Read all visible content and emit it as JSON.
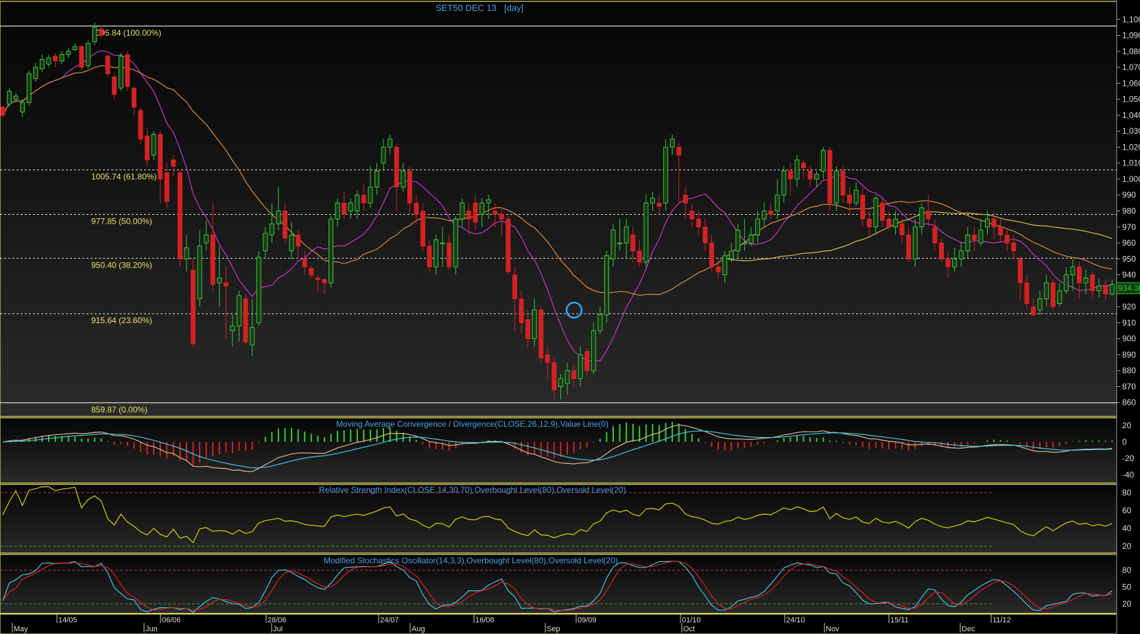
{
  "title": "SET50 DEC 13",
  "period": "[day]",
  "last_price": "934.30",
  "price_axis_labels": [
    "1,100",
    "1,090",
    "1,080",
    "1,070",
    "1,060",
    "1,050",
    "1,040",
    "1,030",
    "1,020",
    "1,010",
    "1,000",
    "990",
    "980",
    "970",
    "960",
    "950",
    "940",
    "930",
    "920",
    "910",
    "900",
    "890",
    "880",
    "870",
    "860"
  ],
  "fib_levels": [
    {
      "label": "1095.84 (100.00%)",
      "value": 1095.84
    },
    {
      "label": "1005.74 (61.80%)",
      "value": 1005.74
    },
    {
      "label": "977.85 (50.00%)",
      "value": 977.85
    },
    {
      "label": "950.40 (38.20%)",
      "value": 950.4
    },
    {
      "label": "915.64 (23.60%)",
      "value": 915.64
    },
    {
      "label": "859.87 (0.00%)",
      "value": 859.87
    }
  ],
  "date_axis_top": [
    "14/05",
    "06/06",
    "28/06",
    "24/07",
    "16/08",
    "09/09",
    "01/10",
    "24/10",
    "15/11",
    "11/12"
  ],
  "date_axis_bottom": [
    "May",
    "Jun",
    "Jul",
    "Aug",
    "Sep",
    "Oct",
    "Nov",
    "Dec"
  ],
  "macd": {
    "title": "Moving Average Convergence / Divergence(CLOSE,26,12,9),Value Line(0)",
    "axis": [
      "20",
      "0",
      "-20",
      "-40"
    ]
  },
  "rsi": {
    "title": "Relative Strength Index(CLOSE,14,30,70),Overbought Level(80),Oversold Level(20)",
    "axis": [
      "80",
      "60",
      "40",
      "20"
    ]
  },
  "stoch": {
    "title": "Modified Stochastics Oscillator(14,3,3),Overbought Level(80),Oversold Level(20)",
    "axis": [
      "80",
      "50",
      "20"
    ]
  },
  "colors": {
    "up": "#33cc33",
    "down": "#d42222",
    "ma_fast": "#cc33cc",
    "ma_slow": "#e08a3c",
    "ma_long": "#d4c24a",
    "rsi": "#d4d400",
    "stoch_k": "#40c8e0",
    "stoch_d": "#e02020",
    "title": "#4a9fe0",
    "frame": "#e8e066"
  },
  "chart_data": {
    "type": "candlestick",
    "title": "SET50 DEC 13",
    "ylim": [
      855,
      1103
    ],
    "candles": [
      [
        1045,
        1040,
        1046,
        1038
      ],
      [
        1047,
        1055,
        1057,
        1045
      ],
      [
        1050,
        1052,
        1054,
        1048
      ],
      [
        1042,
        1048,
        1050,
        1039
      ],
      [
        1048,
        1066,
        1068,
        1046
      ],
      [
        1063,
        1070,
        1073,
        1061
      ],
      [
        1069,
        1075,
        1078,
        1067
      ],
      [
        1072,
        1076,
        1078,
        1070
      ],
      [
        1077,
        1074,
        1079,
        1070
      ],
      [
        1074,
        1078,
        1080,
        1072
      ],
      [
        1078,
        1080,
        1082,
        1076
      ],
      [
        1081,
        1083,
        1085,
        1080
      ],
      [
        1083,
        1070,
        1084,
        1068
      ],
      [
        1071,
        1085,
        1087,
        1069
      ],
      [
        1086,
        1095,
        1098,
        1084
      ],
      [
        1094,
        1090,
        1096,
        1088
      ],
      [
        1077,
        1066,
        1078,
        1064
      ],
      [
        1064,
        1053,
        1066,
        1050
      ],
      [
        1057,
        1077,
        1079,
        1055
      ],
      [
        1078,
        1058,
        1080,
        1055
      ],
      [
        1057,
        1045,
        1058,
        1040
      ],
      [
        1043,
        1025,
        1045,
        1022
      ],
      [
        1027,
        1012,
        1032,
        1008
      ],
      [
        1015,
        1028,
        1030,
        1012
      ],
      [
        1028,
        1000,
        1030,
        985
      ],
      [
        1004,
        986,
        1010,
        982
      ],
      [
        1012,
        1008,
        1015,
        1002
      ],
      [
        1004,
        950,
        1006,
        945
      ],
      [
        950,
        957,
        965,
        942
      ],
      [
        943,
        897,
        950,
        895
      ],
      [
        925,
        958,
        968,
        920
      ],
      [
        960,
        965,
        974,
        955
      ],
      [
        965,
        934,
        985,
        930
      ],
      [
        935,
        938,
        958,
        920
      ],
      [
        935,
        933,
        945,
        900
      ],
      [
        905,
        908,
        915,
        895
      ],
      [
        908,
        927,
        930,
        898
      ],
      [
        925,
        898,
        928,
        896
      ],
      [
        896,
        907,
        925,
        889
      ],
      [
        910,
        951,
        955,
        908
      ],
      [
        955,
        966,
        970,
        950
      ],
      [
        965,
        972,
        985,
        960
      ],
      [
        972,
        980,
        995,
        968
      ],
      [
        980,
        963,
        985,
        960
      ],
      [
        955,
        965,
        973,
        950
      ],
      [
        965,
        958,
        968,
        950
      ],
      [
        950,
        945,
        955,
        940
      ],
      [
        944,
        940,
        946,
        938
      ],
      [
        938,
        937,
        940,
        930
      ],
      [
        937,
        935,
        938,
        928
      ],
      [
        935,
        975,
        977,
        932
      ],
      [
        975,
        985,
        988,
        970
      ],
      [
        985,
        978,
        992,
        975
      ],
      [
        980,
        985,
        988,
        975
      ],
      [
        980,
        990,
        993,
        975
      ],
      [
        990,
        985,
        997,
        980
      ],
      [
        985,
        995,
        1008,
        982
      ],
      [
        995,
        1005,
        1010,
        990
      ],
      [
        1010,
        1020,
        1025,
        1005
      ],
      [
        1020,
        1025,
        1028,
        1015
      ],
      [
        1020,
        995,
        1022,
        980
      ],
      [
        995,
        1005,
        1010,
        992
      ],
      [
        1005,
        985,
        1008,
        978
      ],
      [
        985,
        978,
        990,
        972
      ],
      [
        980,
        958,
        985,
        955
      ],
      [
        958,
        945,
        962,
        942
      ],
      [
        945,
        962,
        965,
        940
      ],
      [
        960,
        960,
        970,
        945
      ],
      [
        960,
        945,
        965,
        943
      ],
      [
        945,
        975,
        977,
        940
      ],
      [
        975,
        985,
        988,
        970
      ],
      [
        980,
        975,
        985,
        965
      ],
      [
        985,
        973,
        990,
        968
      ],
      [
        978,
        985,
        988,
        970
      ],
      [
        985,
        987,
        990,
        975
      ],
      [
        980,
        978,
        985,
        970
      ],
      [
        978,
        975,
        982,
        965
      ],
      [
        975,
        942,
        977,
        940
      ],
      [
        940,
        925,
        945,
        905
      ],
      [
        925,
        910,
        930,
        903
      ],
      [
        912,
        900,
        918,
        895
      ],
      [
        900,
        918,
        925,
        895
      ],
      [
        918,
        888,
        920,
        885
      ],
      [
        890,
        885,
        895,
        875
      ],
      [
        885,
        868,
        888,
        862
      ],
      [
        870,
        875,
        878,
        862
      ],
      [
        872,
        880,
        885,
        865
      ],
      [
        880,
        875,
        883,
        870
      ],
      [
        875,
        890,
        895,
        870
      ],
      [
        892,
        880,
        894,
        876
      ],
      [
        880,
        905,
        910,
        878
      ],
      [
        905,
        915,
        920,
        903
      ],
      [
        915,
        952,
        955,
        910
      ],
      [
        950,
        968,
        972,
        945
      ],
      [
        960,
        960,
        975,
        955
      ],
      [
        960,
        970,
        975,
        950
      ],
      [
        965,
        955,
        970,
        948
      ],
      [
        955,
        948,
        962,
        945
      ],
      [
        948,
        985,
        990,
        945
      ],
      [
        985,
        988,
        992,
        980
      ],
      [
        985,
        983,
        990,
        978
      ],
      [
        985,
        1020,
        1025,
        980
      ],
      [
        1020,
        1025,
        1028,
        1015
      ],
      [
        1020,
        1015,
        1023,
        985
      ],
      [
        990,
        985,
        995,
        975
      ],
      [
        980,
        975,
        985,
        970
      ],
      [
        975,
        970,
        980,
        965
      ],
      [
        970,
        960,
        975,
        955
      ],
      [
        960,
        945,
        965,
        942
      ],
      [
        945,
        942,
        950,
        938
      ],
      [
        940,
        952,
        955,
        935
      ],
      [
        950,
        955,
        960,
        948
      ],
      [
        955,
        968,
        972,
        950
      ],
      [
        960,
        960,
        975,
        955
      ],
      [
        960,
        965,
        970,
        958
      ],
      [
        965,
        975,
        980,
        960
      ],
      [
        975,
        980,
        985,
        970
      ],
      [
        980,
        978,
        985,
        975
      ],
      [
        980,
        990,
        1000,
        975
      ],
      [
        990,
        1005,
        1008,
        985
      ],
      [
        1005,
        1000,
        1010,
        990
      ],
      [
        1000,
        1012,
        1015,
        995
      ],
      [
        1010,
        1007,
        1012,
        1000
      ],
      [
        1005,
        1000,
        1008,
        995
      ],
      [
        1000,
        1003,
        1005,
        995
      ],
      [
        1005,
        1018,
        1020,
        1000
      ],
      [
        1018,
        985,
        1020,
        980
      ],
      [
        985,
        1005,
        1008,
        980
      ],
      [
        1005,
        990,
        1008,
        985
      ],
      [
        990,
        985,
        995,
        978
      ],
      [
        985,
        993,
        998,
        983
      ],
      [
        990,
        975,
        995,
        970
      ],
      [
        975,
        970,
        980,
        965
      ],
      [
        970,
        988,
        990,
        965
      ],
      [
        985,
        974,
        988,
        970
      ],
      [
        975,
        970,
        980,
        968
      ],
      [
        970,
        975,
        980,
        965
      ],
      [
        972,
        965,
        975,
        960
      ],
      [
        965,
        950,
        970,
        948
      ],
      [
        950,
        970,
        975,
        945
      ],
      [
        970,
        982,
        985,
        965
      ],
      [
        980,
        975,
        990,
        970
      ],
      [
        970,
        960,
        975,
        955
      ],
      [
        960,
        950,
        963,
        948
      ],
      [
        950,
        945,
        955,
        938
      ],
      [
        945,
        950,
        957,
        942
      ],
      [
        950,
        955,
        960,
        945
      ],
      [
        955,
        965,
        970,
        950
      ],
      [
        965,
        962,
        970,
        955
      ],
      [
        960,
        968,
        975,
        958
      ],
      [
        970,
        975,
        980,
        965
      ],
      [
        975,
        970,
        980,
        962
      ],
      [
        970,
        965,
        975,
        960
      ],
      [
        965,
        960,
        968,
        955
      ],
      [
        960,
        955,
        965,
        950
      ],
      [
        950,
        935,
        952,
        925
      ],
      [
        935,
        922,
        940,
        918
      ],
      [
        920,
        915,
        925,
        914
      ],
      [
        918,
        925,
        930,
        915
      ],
      [
        925,
        935,
        940,
        920
      ],
      [
        935,
        920,
        937,
        918
      ],
      [
        922,
        930,
        935,
        920
      ],
      [
        930,
        940,
        945,
        928
      ],
      [
        940,
        945,
        950,
        930
      ],
      [
        945,
        935,
        948,
        925
      ],
      [
        935,
        938,
        943,
        928
      ],
      [
        940,
        930,
        942,
        925
      ],
      [
        930,
        933,
        938,
        926
      ],
      [
        933,
        928,
        937,
        924
      ],
      [
        928,
        934,
        937,
        927
      ]
    ],
    "fibonacci": [
      1095.84,
      1005.74,
      977.85,
      950.4,
      915.64,
      859.87
    ],
    "series": [
      {
        "name": "MACD(CLOSE,26,12,9)",
        "range": [
          -45,
          25
        ]
      },
      {
        "name": "RSI(CLOSE,14,30,70)",
        "range": [
          10,
          85
        ],
        "overbought": 80,
        "oversold": 20
      },
      {
        "name": "Modified Stochastics(14,3,3)",
        "range": [
          10,
          95
        ],
        "overbought": 80,
        "oversold": 20
      }
    ]
  }
}
